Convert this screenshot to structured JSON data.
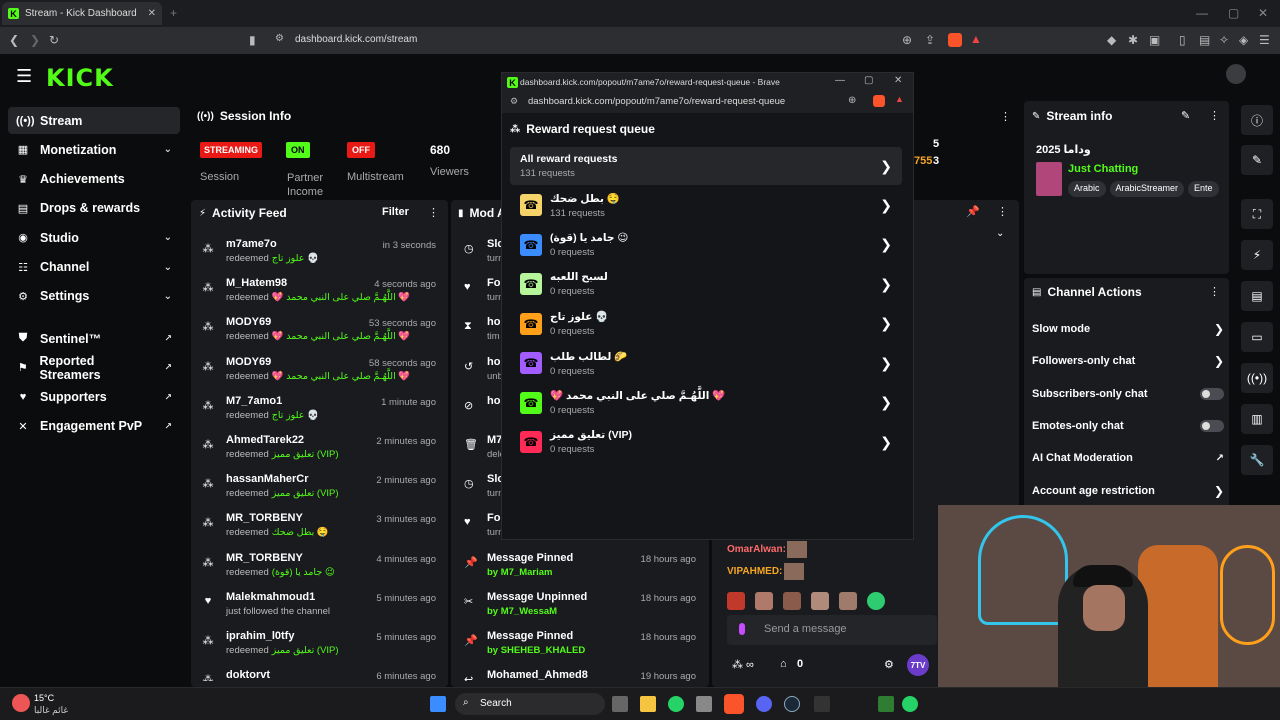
{
  "browser": {
    "tab_title": "Stream - Kick Dashboard",
    "address": "dashboard.kick.com/stream"
  },
  "logo": "KICK",
  "nav": [
    {
      "label": "Stream",
      "icon": "stream-icon",
      "active": true,
      "chevron": false
    },
    {
      "label": "Monetization",
      "icon": "monetization-icon",
      "chevron": true
    },
    {
      "label": "Achievements",
      "icon": "trophy-icon",
      "chevron": false
    },
    {
      "label": "Drops & rewards",
      "icon": "drops-icon",
      "chevron": false
    },
    {
      "label": "Studio",
      "icon": "studio-icon",
      "chevron": true
    },
    {
      "label": "Channel",
      "icon": "channel-icon",
      "chevron": true
    },
    {
      "label": "Settings",
      "icon": "gear-icon",
      "chevron": true
    }
  ],
  "nav2": [
    {
      "label": "Sentinel™",
      "icon": "shield-icon"
    },
    {
      "label": "Reported Streamers",
      "icon": "flag-icon"
    },
    {
      "label": "Supporters",
      "icon": "heart-icon"
    },
    {
      "label": "Engagement PvP",
      "icon": "swords-icon"
    }
  ],
  "session": {
    "title": "Session Info",
    "streaming": "STREAMING",
    "session_label": "Session",
    "on": "ON",
    "partner_label": "Partner Income",
    "off": "OFF",
    "multistream_label": "Multistream",
    "viewers": "680",
    "viewers_label": "Viewers"
  },
  "activity": {
    "title": "Activity Feed",
    "filter": "Filter",
    "items": [
      {
        "user": "m7ame7o",
        "time": "in 3 seconds",
        "action": "redeemed",
        "reward": "علوز تاج 💀"
      },
      {
        "user": "M_Hatem98",
        "time": "4 seconds ago",
        "action": "redeemed",
        "reward": "💖 اللَّهُـمَّ صلي على النبي محمد 💖"
      },
      {
        "user": "MODY69",
        "time": "53 seconds ago",
        "action": "redeemed",
        "reward": "💖 اللَّهُـمَّ صلي على النبي محمد 💖"
      },
      {
        "user": "MODY69",
        "time": "58 seconds ago",
        "action": "redeemed",
        "reward": "💖 اللَّهُـمَّ صلي على النبي محمد 💖"
      },
      {
        "user": "M7_7amo1",
        "time": "1 minute ago",
        "action": "redeemed",
        "reward": "علوز تاج 💀"
      },
      {
        "user": "AhmedTarek22",
        "time": "2 minutes ago",
        "action": "redeemed",
        "reward": "تعليق مميز (VIP)"
      },
      {
        "user": "hassanMaherCr",
        "time": "2 minutes ago",
        "action": "redeemed",
        "reward": "تعليق مميز (VIP)"
      },
      {
        "user": "MR_TORBENY",
        "time": "3 minutes ago",
        "action": "redeemed",
        "reward": "بطل ضحك 🤤"
      },
      {
        "user": "MR_TORBENY",
        "time": "4 minutes ago",
        "action": "redeemed",
        "reward": "جامد يا (قوة) 😉"
      },
      {
        "user": "Malekmahmoud1",
        "time": "5 minutes ago",
        "action": "just followed the channel",
        "reward": ""
      },
      {
        "user": "iprahim_l0tfy",
        "time": "5 minutes ago",
        "action": "redeemed",
        "reward": "تعليق مميز (VIP)"
      },
      {
        "user": "doktorvt",
        "time": "6 minutes ago",
        "action": "",
        "reward": ""
      }
    ]
  },
  "modlog": {
    "title": "Mod A",
    "items": [
      {
        "title": "Slo",
        "sub": "turn",
        "time": ""
      },
      {
        "title": "Fol",
        "sub": "turn",
        "time": ""
      },
      {
        "title": "hol",
        "sub": "tim",
        "time": ""
      },
      {
        "title": "hol",
        "sub": "unb",
        "time": ""
      },
      {
        "title": "hol",
        "sub": "",
        "time": ""
      },
      {
        "title": "M7",
        "sub": "dele",
        "time": ""
      },
      {
        "title": "Slo",
        "sub": "turn",
        "time": ""
      },
      {
        "title": "Fol",
        "sub": "turn",
        "time": ""
      },
      {
        "title": "Message Pinned",
        "sub": "by M7_Mariam",
        "time": "18 hours ago"
      },
      {
        "title": "Message Unpinned",
        "sub": "by M7_WessaM",
        "time": "18 hours ago"
      },
      {
        "title": "Message Pinned",
        "sub": "by SHEHEB_KHALED",
        "time": "18 hours ago"
      },
      {
        "title": "Mohamed_Ahmed8",
        "sub": "",
        "time": "19 hours ago"
      }
    ]
  },
  "chat": {
    "user1": "OmarAlwan:",
    "user2": "VIPAHMED:",
    "placeholder": "Send a message",
    "count": "0",
    "badge": "7TV"
  },
  "stream_info": {
    "title": "Stream info",
    "stream_title": "وداما 2025",
    "category": "Just Chatting",
    "tags": [
      "Arabic",
      "ArabicStreamer",
      "Ente"
    ]
  },
  "stats": {
    "a": "5",
    "b": "755",
    "c": "3"
  },
  "channel_actions": {
    "title": "Channel Actions",
    "items": [
      {
        "label": "Slow mode",
        "type": "chevron"
      },
      {
        "label": "Followers-only chat",
        "type": "chevron"
      },
      {
        "label": "Subscribers-only chat",
        "type": "toggle"
      },
      {
        "label": "Emotes-only chat",
        "type": "toggle"
      },
      {
        "label": "AI Chat Moderation",
        "type": "external"
      },
      {
        "label": "Account age restriction",
        "type": "chevron"
      }
    ]
  },
  "popup": {
    "window_title": "dashboard.kick.com/popout/m7ame7o/reward-request-queue - Brave",
    "address": "dashboard.kick.com/popout/m7ame7o/reward-request-queue",
    "heading": "Reward request queue",
    "all_label": "All reward requests",
    "all_count": "131 requests",
    "rewards": [
      {
        "name": "بطل ضحك 🤤",
        "count": "131 requests",
        "color": "#f5d36b"
      },
      {
        "name": "جامد يا (قوة) 😉",
        "count": "0 requests",
        "color": "#3b8cff"
      },
      {
        "name": "لسبح اللعبه",
        "count": "0 requests",
        "color": "#b7f59b"
      },
      {
        "name": "علوز تاج 💀",
        "count": "0 requests",
        "color": "#ff9f1a"
      },
      {
        "name": "لطالب طلب 🌮",
        "count": "0 requests",
        "color": "#a35cff"
      },
      {
        "name": "💖 اللَّهُـمَّ صلي على النبي محمد 💖",
        "count": "0 requests",
        "color": "#53fc18"
      },
      {
        "name": "تعليق مميز (VIP)",
        "count": "0 requests",
        "color": "#ff2a55"
      }
    ]
  },
  "taskbar": {
    "temp": "15°C",
    "weather": "غائم غالبا",
    "search": "Search"
  }
}
